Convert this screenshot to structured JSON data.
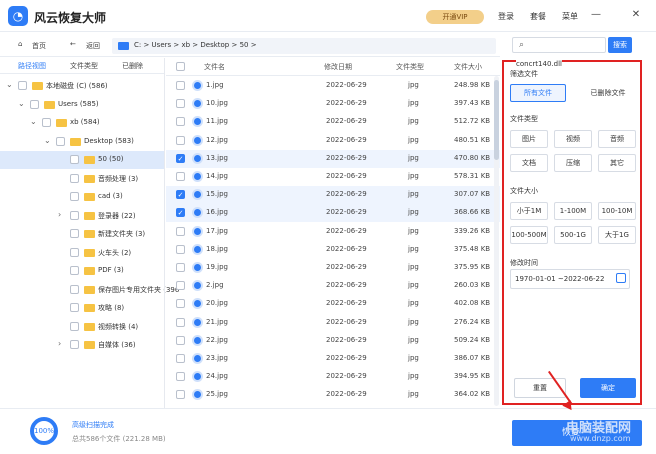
{
  "app": {
    "title": "风云恢复大师",
    "logo_glyph": "◔",
    "vip_label": "开通VIP",
    "login": "登录",
    "package": "套餐",
    "menu": "菜单"
  },
  "window": {
    "minimize": "—",
    "close": "✕"
  },
  "nav": {
    "home": "首页",
    "back": "返回",
    "path": "C: > Users > xb > Desktop > 50 >"
  },
  "left_tabs": [
    "路径视图",
    "文件类型",
    "已删除"
  ],
  "tree": [
    {
      "label": "本地磁盘 (C) (586)",
      "checked": false,
      "expanded": true,
      "sel": false
    },
    {
      "label": "Users (585)",
      "checked": false,
      "expanded": true,
      "sel": false
    },
    {
      "label": "xb (584)",
      "checked": false,
      "expanded": true,
      "sel": false
    },
    {
      "label": "Desktop (583)",
      "checked": false,
      "expanded": true,
      "sel": false
    },
    {
      "label": "50 (50)",
      "checked": false,
      "expanded": false,
      "sel": true
    },
    {
      "label": "音频处理 (3)",
      "checked": false,
      "expanded": false,
      "sel": false
    },
    {
      "label": "cad (3)",
      "checked": false,
      "expanded": false,
      "sel": false
    },
    {
      "label": "登录器 (22)",
      "checked": false,
      "expanded": false,
      "sel": false
    },
    {
      "label": "新建文件夹 (3)",
      "checked": false,
      "expanded": false,
      "sel": false
    },
    {
      "label": "火车头 (2)",
      "checked": false,
      "expanded": false,
      "sel": false
    },
    {
      "label": "PDF (3)",
      "checked": false,
      "expanded": false,
      "sel": false
    },
    {
      "label": "保存图片专用文件夹 (396",
      "checked": false,
      "expanded": false,
      "sel": false
    },
    {
      "label": "攻略 (8)",
      "checked": false,
      "expanded": false,
      "sel": false
    },
    {
      "label": "视频转换 (4)",
      "checked": false,
      "expanded": false,
      "sel": false
    },
    {
      "label": "自媒体 (36)",
      "checked": false,
      "expanded": false,
      "sel": false
    }
  ],
  "table": {
    "headers": [
      "文件名",
      "修改日期",
      "文件类型",
      "文件大小"
    ],
    "rows": [
      {
        "name": "1.jpg",
        "date": "2022-06-29",
        "type": "jpg",
        "size": "248.98 KB",
        "checked": false
      },
      {
        "name": "10.jpg",
        "date": "2022-06-29",
        "type": "jpg",
        "size": "397.43 KB",
        "checked": false
      },
      {
        "name": "11.jpg",
        "date": "2022-06-29",
        "type": "jpg",
        "size": "512.72 KB",
        "checked": false
      },
      {
        "name": "12.jpg",
        "date": "2022-06-29",
        "type": "jpg",
        "size": "480.51 KB",
        "checked": false
      },
      {
        "name": "13.jpg",
        "date": "2022-06-29",
        "type": "jpg",
        "size": "470.80 KB",
        "checked": true
      },
      {
        "name": "14.jpg",
        "date": "2022-06-29",
        "type": "jpg",
        "size": "578.31 KB",
        "checked": false
      },
      {
        "name": "15.jpg",
        "date": "2022-06-29",
        "type": "jpg",
        "size": "307.07 KB",
        "checked": true
      },
      {
        "name": "16.jpg",
        "date": "2022-06-29",
        "type": "jpg",
        "size": "368.66 KB",
        "checked": true
      },
      {
        "name": "17.jpg",
        "date": "2022-06-29",
        "type": "jpg",
        "size": "339.26 KB",
        "checked": false
      },
      {
        "name": "18.jpg",
        "date": "2022-06-29",
        "type": "jpg",
        "size": "375.48 KB",
        "checked": false
      },
      {
        "name": "19.jpg",
        "date": "2022-06-29",
        "type": "jpg",
        "size": "375.95 KB",
        "checked": false
      },
      {
        "name": "2.jpg",
        "date": "2022-06-29",
        "type": "jpg",
        "size": "260.03 KB",
        "checked": false
      },
      {
        "name": "20.jpg",
        "date": "2022-06-29",
        "type": "jpg",
        "size": "402.08 KB",
        "checked": false
      },
      {
        "name": "21.jpg",
        "date": "2022-06-29",
        "type": "jpg",
        "size": "276.24 KB",
        "checked": false
      },
      {
        "name": "22.jpg",
        "date": "2022-06-29",
        "type": "jpg",
        "size": "509.24 KB",
        "checked": false
      },
      {
        "name": "23.jpg",
        "date": "2022-06-29",
        "type": "jpg",
        "size": "386.07 KB",
        "checked": false
      },
      {
        "name": "24.jpg",
        "date": "2022-06-29",
        "type": "jpg",
        "size": "394.95 KB",
        "checked": false
      },
      {
        "name": "25.jpg",
        "date": "2022-06-29",
        "type": "jpg",
        "size": "364.02 KB",
        "checked": false
      }
    ]
  },
  "search": {
    "button": "搜索"
  },
  "filter": {
    "dll_note": "concrt140.dll",
    "scope": {
      "heading": "筛选文件",
      "all": "所有文件",
      "deleted": "已删除文件"
    },
    "type": {
      "heading": "文件类型",
      "items": [
        "图片",
        "视频",
        "音频",
        "文档",
        "压缩",
        "其它"
      ]
    },
    "size": {
      "heading": "文件大小",
      "items": [
        "小于1M",
        "1-100M",
        "100-10M",
        "100-500M",
        "500-1G",
        "大于1G"
      ]
    },
    "date": {
      "heading": "修改时间",
      "range": "1970-01-01 ~2022-06-22"
    },
    "reset": "重置",
    "ok": "确定"
  },
  "bottom": {
    "progress": "100%",
    "status": "高级扫描完成",
    "summary": "总共586个文件 (221.28 MB)",
    "recover": "恢复",
    "watermark1": "电脑装配网",
    "watermark2": "www.dnzp.com"
  },
  "colors": {
    "accent": "#2e7cf6",
    "highlight": "#e02222",
    "folder": "#f6c343",
    "vip": "#f3cf8a"
  }
}
